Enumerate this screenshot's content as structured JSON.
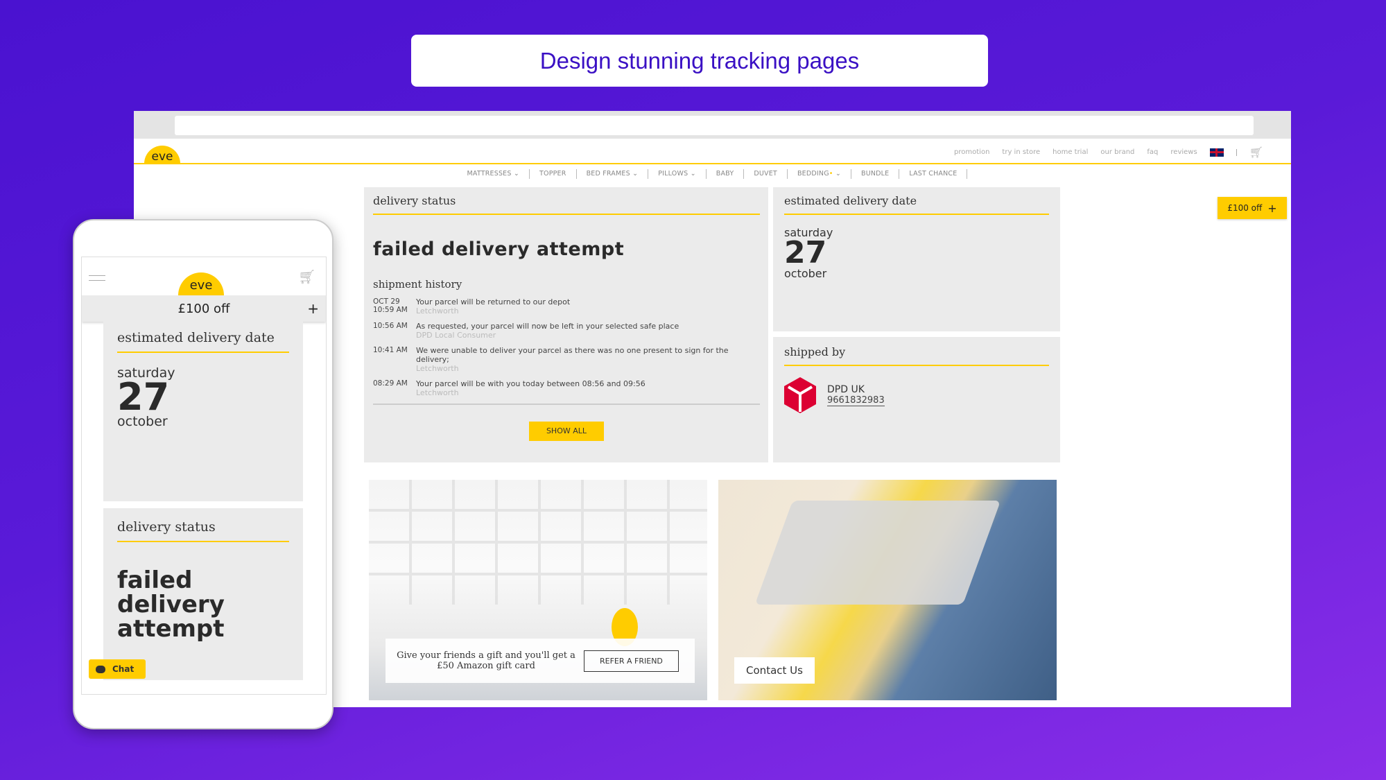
{
  "banner": {
    "title": "Design stunning tracking pages"
  },
  "site": {
    "logo": "eve",
    "top_links": [
      "promotion",
      "try in store",
      "home trial",
      "our brand",
      "faq",
      "reviews"
    ],
    "nav": [
      {
        "label": "MATTRESSES",
        "dropdown": true
      },
      {
        "label": "TOPPER"
      },
      {
        "label": "BED FRAMES",
        "dropdown": true
      },
      {
        "label": "PILLOWS",
        "dropdown": true
      },
      {
        "label": "BABY"
      },
      {
        "label": "DUVET"
      },
      {
        "label": "BEDDING",
        "dropdown": true,
        "dot": true
      },
      {
        "label": "BUNDLE"
      },
      {
        "label": "LAST CHANCE"
      }
    ],
    "offer": "£100 off",
    "accent": "#ffcc00"
  },
  "delivery": {
    "heading": "delivery status",
    "status": "failed delivery attempt",
    "history_heading": "shipment history",
    "history": [
      {
        "date": "OCT 29",
        "time": "10:59 AM",
        "text": "Your parcel will be returned to our depot",
        "location": "Letchworth"
      },
      {
        "time": "10:56 AM",
        "text": "As requested, your parcel will now be left in your selected safe place",
        "location": "DPD Local Consumer"
      },
      {
        "time": "10:41 AM",
        "text": "We were unable to deliver your parcel as there was no one present to sign for the delivery;",
        "location": "Letchworth"
      },
      {
        "time": "08:29 AM",
        "text": "Your parcel will be with you today between 08:56 and 09:56",
        "location": "Letchworth"
      }
    ],
    "show_all": "SHOW ALL"
  },
  "estimate": {
    "heading": "estimated delivery date",
    "weekday": "saturday",
    "day": "27",
    "month": "october"
  },
  "shipped": {
    "heading": "shipped by",
    "carrier": "DPD UK",
    "tracking": "9661832983"
  },
  "promo": {
    "text": "Give your friends a gift and you'll get a £50 Amazon gift card",
    "refer": "REFER A FRIEND",
    "contact": "Contact Us"
  },
  "mobile": {
    "logo": "eve",
    "offer": "£100 off",
    "est_heading": "estimated delivery date",
    "weekday": "saturday",
    "day": "27",
    "month": "october",
    "status_heading": "delivery status",
    "status": "failed delivery attempt",
    "chat": "Chat"
  }
}
